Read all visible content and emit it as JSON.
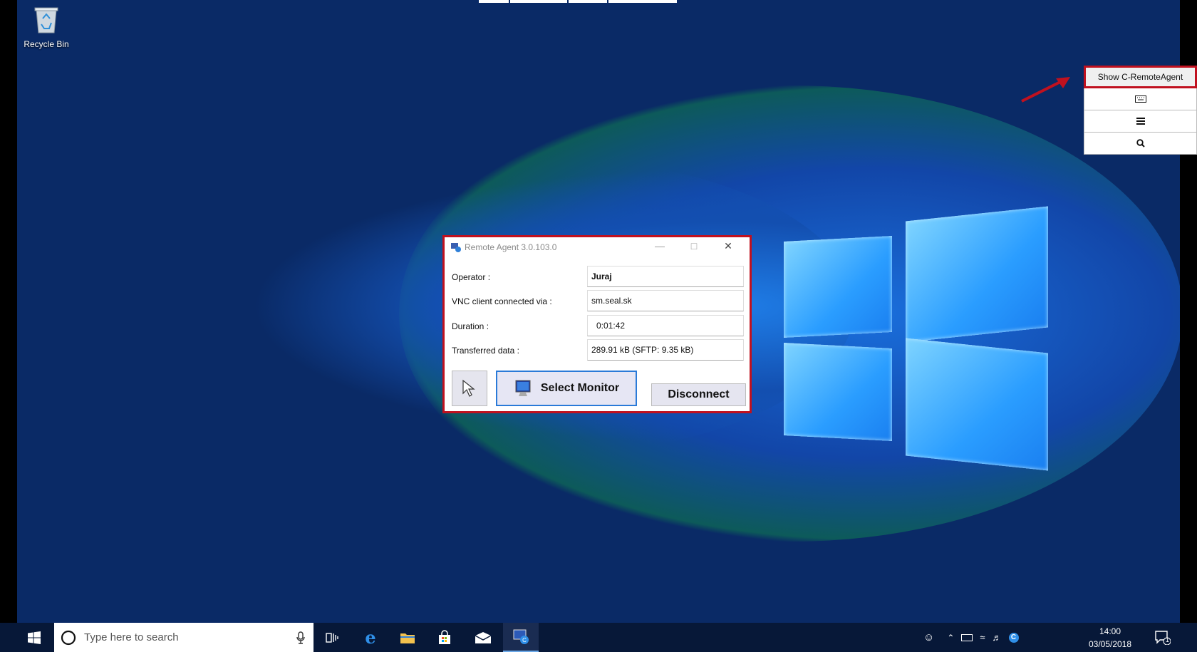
{
  "desktop": {
    "recycle_bin_label": "Recycle Bin"
  },
  "right_toolbar": {
    "show_label": "Show C-RemoteAgent",
    "keyboard_icon": "keyboard-icon",
    "menu_icon": "hamburger-menu-icon",
    "search_icon": "search-icon"
  },
  "dialog": {
    "title": "Remote Agent 3.0.103.0",
    "fields": [
      {
        "label": "Operator :",
        "value": "Juraj"
      },
      {
        "label": "VNC client connected via :",
        "value": "sm.seal.sk"
      },
      {
        "label": "Duration :",
        "value": "0:01:42"
      },
      {
        "label": "Transferred data :",
        "value": "289.91 kB (SFTP: 9.35 kB)"
      }
    ],
    "select_monitor_label": "Select Monitor",
    "disconnect_label": "Disconnect"
  },
  "taskbar": {
    "search_placeholder": "Type here to search",
    "time": "14:00",
    "date": "03/05/2018",
    "notification_count": "1"
  },
  "colors": {
    "highlight_border": "#c0111f",
    "desktop_bg": "#0a2a66",
    "taskbar_bg": "#071838"
  }
}
